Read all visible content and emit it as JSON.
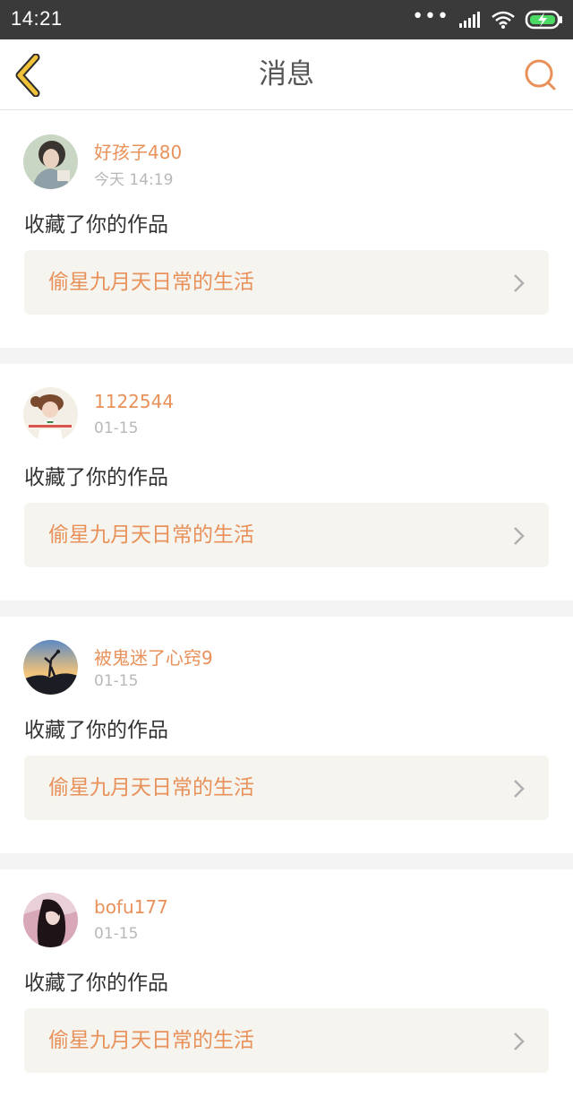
{
  "status_bar": {
    "time": "14:21",
    "signal_dots": "•••"
  },
  "nav": {
    "title": "消息"
  },
  "colors": {
    "accent": "#e8915a",
    "back": "#f0c23a",
    "work_bg": "#f5f4ef"
  },
  "messages": [
    {
      "username": "好孩子480",
      "time": "今天 14:19",
      "action": "收藏了你的作品",
      "work_title": "偷星九月天日常的生活"
    },
    {
      "username": "1122544",
      "time": "01-15",
      "action": "收藏了你的作品",
      "work_title": "偷星九月天日常的生活"
    },
    {
      "username": "被鬼迷了心窍9",
      "time": "01-15",
      "action": "收藏了你的作品",
      "work_title": "偷星九月天日常的生活"
    },
    {
      "username": "bofu177",
      "time": "01-15",
      "action": "收藏了你的作品",
      "work_title": "偷星九月天日常的生活"
    }
  ]
}
